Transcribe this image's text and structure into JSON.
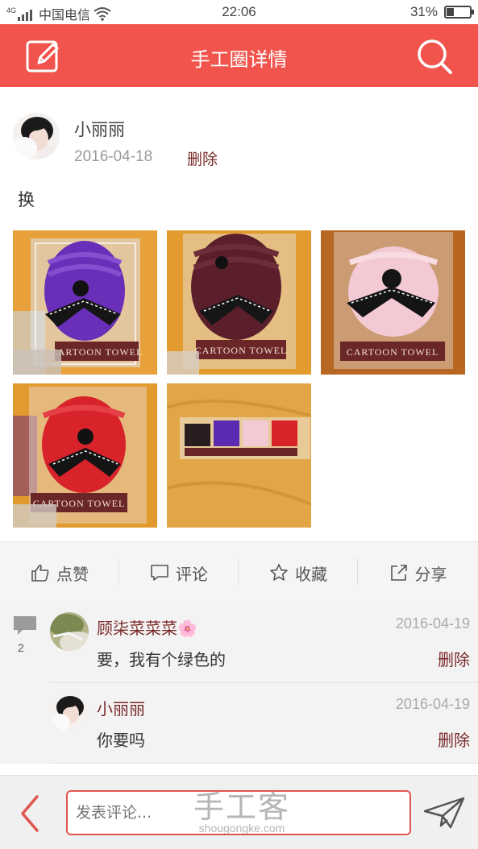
{
  "status_bar": {
    "signal": "4G",
    "carrier": "中国电信",
    "time": "22:06",
    "battery": "31%",
    "battery_level": 0.31
  },
  "header": {
    "title": "手工圈详情",
    "left_icon": "edit-icon",
    "right_icon": "search-icon",
    "bg_color": "#f1544d"
  },
  "post": {
    "author": "小丽丽",
    "date": "2016-04-18",
    "delete_label": "删除",
    "text": "换",
    "photos": [
      {
        "name": "purple-towel",
        "body_color": "#6a2fb8",
        "label": "CARTOON TOWEL"
      },
      {
        "name": "brown-towel",
        "body_color": "#5a1f2a",
        "label": "CARTOON TOWEL"
      },
      {
        "name": "pink-towel",
        "body_color": "#f3c9d4",
        "label": "CARTOON TOWEL"
      },
      {
        "name": "red-towel",
        "body_color": "#d8232a",
        "label": "CARTOON TOWEL"
      },
      {
        "name": "group-towels",
        "body_color": "#e3a646",
        "label": ""
      }
    ]
  },
  "actions": [
    {
      "icon": "thumbs-up-icon",
      "label": "点赞"
    },
    {
      "icon": "comment-icon",
      "label": "评论"
    },
    {
      "icon": "star-icon",
      "label": "收藏"
    },
    {
      "icon": "share-icon",
      "label": "分享"
    }
  ],
  "comments": {
    "count": "2",
    "items": [
      {
        "name": "顾柒菜菜菜🌸",
        "date": "2016-04-19",
        "text": "要，我有个绿色的",
        "delete_label": "删除"
      },
      {
        "name": "小丽丽",
        "date": "2016-04-19",
        "text": "你要吗",
        "delete_label": "删除"
      }
    ]
  },
  "bottom_bar": {
    "placeholder": "发表评论...",
    "watermark_cn": "手工客",
    "watermark_en": "shougongke.com"
  }
}
